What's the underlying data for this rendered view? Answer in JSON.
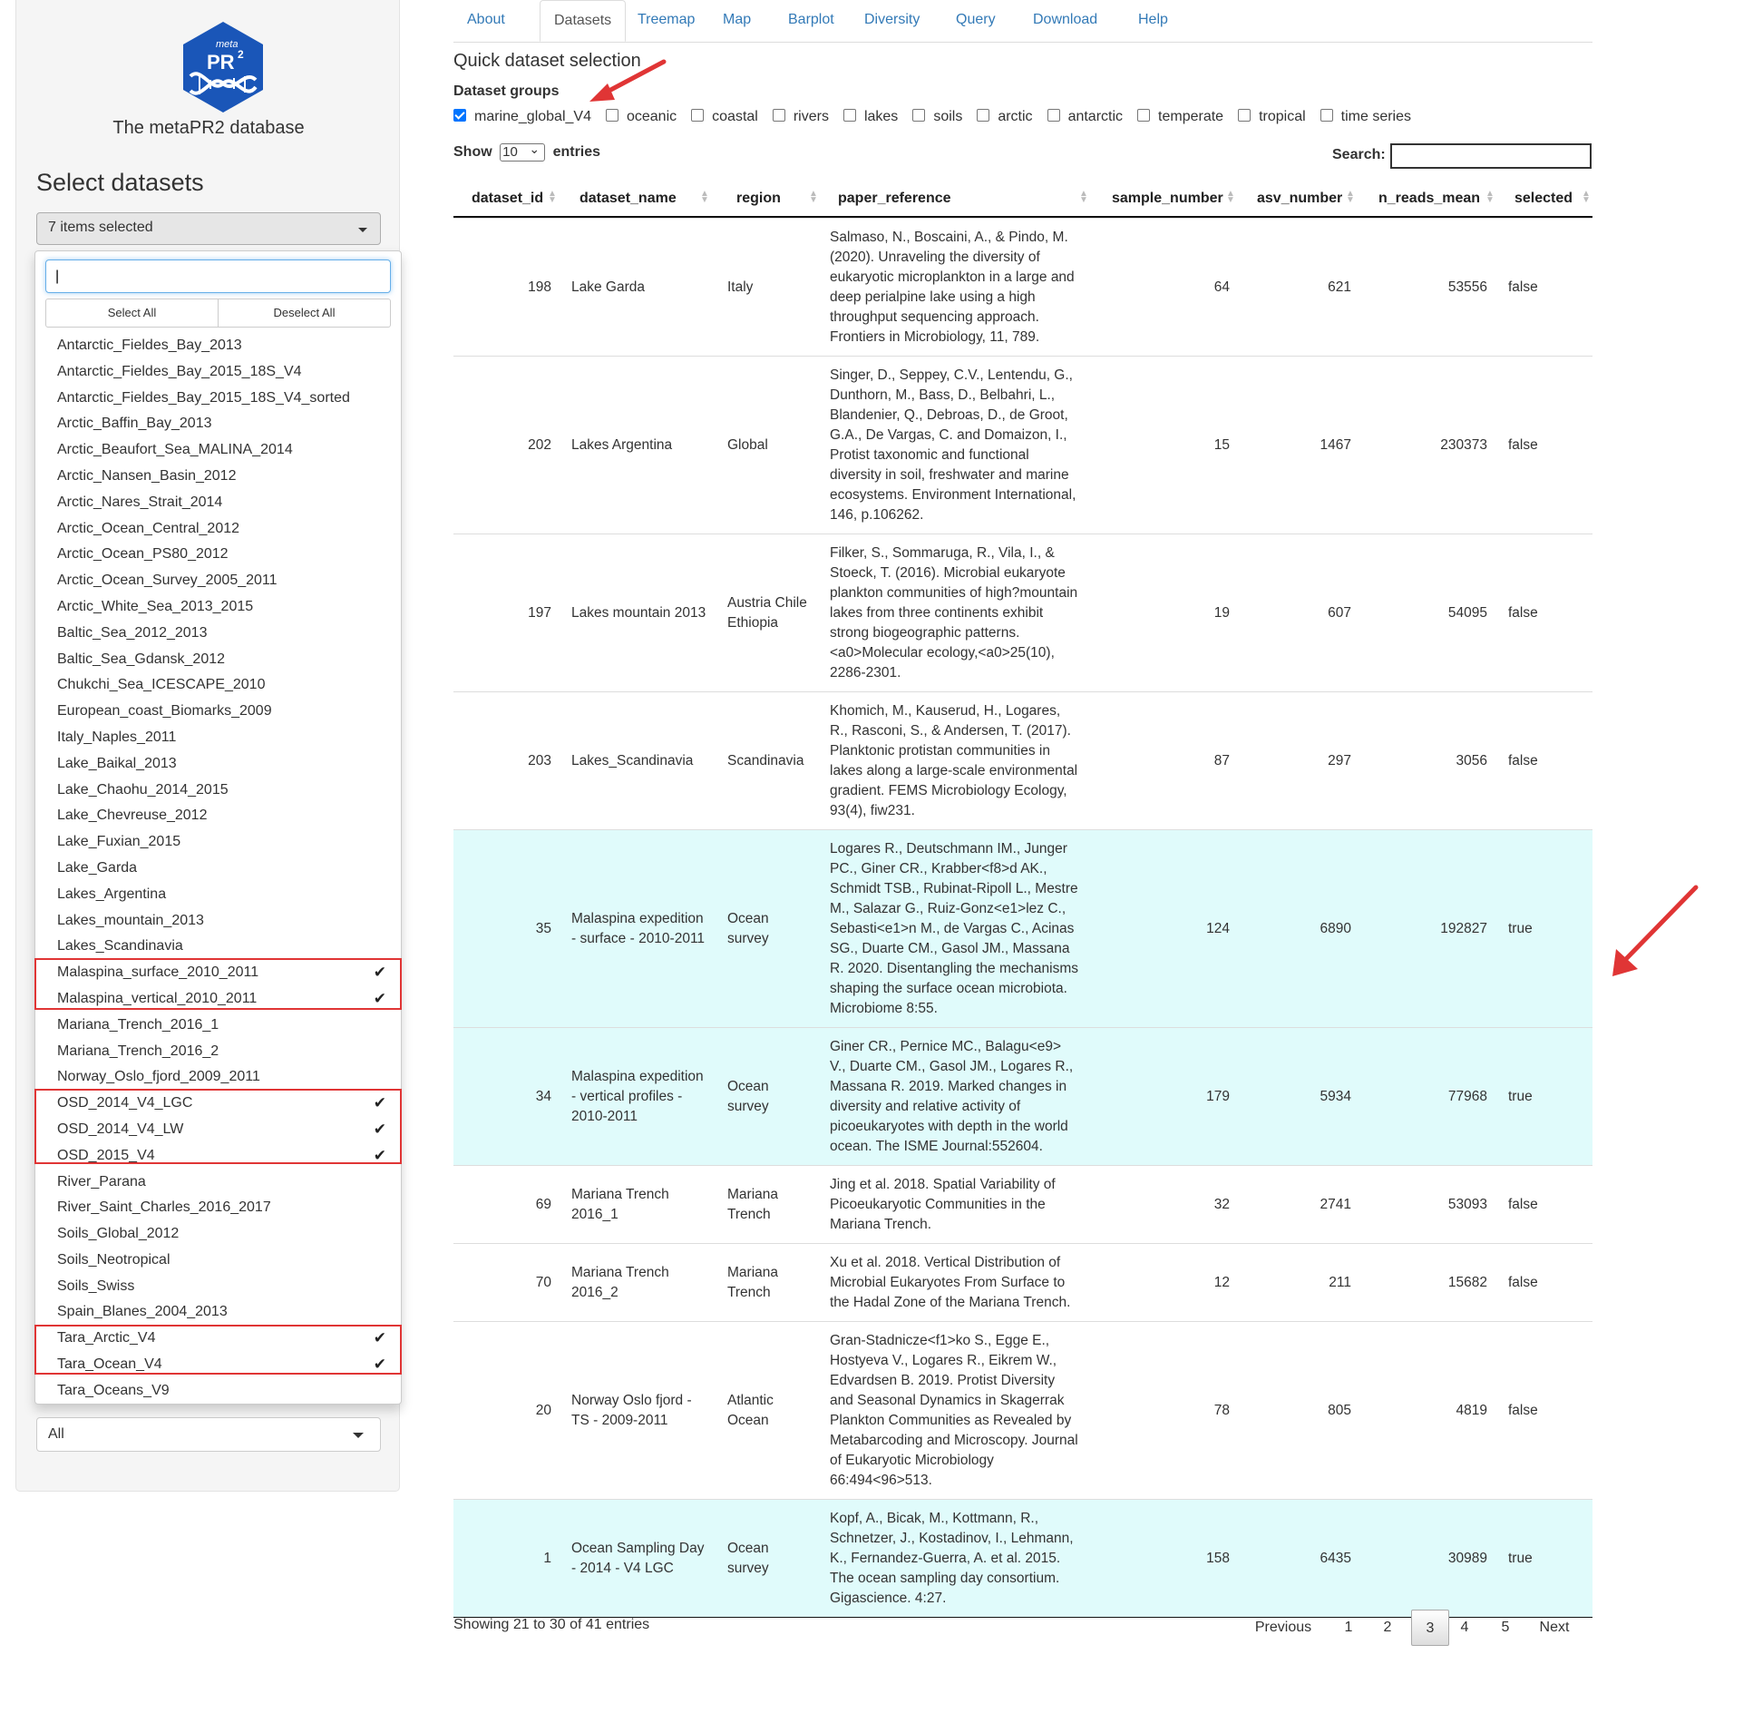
{
  "app": {
    "logo_top": "meta",
    "logo_main": "PR",
    "logo_sup": "2",
    "name": "The metaPR2 database",
    "select_title": "Select datasets",
    "selected_summary": "7 items selected",
    "species_value": "All"
  },
  "dropdown": {
    "search_value": "|",
    "select_all": "Select All",
    "deselect_all": "Deselect All",
    "items": [
      {
        "label": "Antarctic_Fieldes_Bay_2013",
        "checked": false
      },
      {
        "label": "Antarctic_Fieldes_Bay_2015_18S_V4",
        "checked": false
      },
      {
        "label": "Antarctic_Fieldes_Bay_2015_18S_V4_sorted",
        "checked": false
      },
      {
        "label": "Arctic_Baffin_Bay_2013",
        "checked": false
      },
      {
        "label": "Arctic_Beaufort_Sea_MALINA_2014",
        "checked": false
      },
      {
        "label": "Arctic_Nansen_Basin_2012",
        "checked": false
      },
      {
        "label": "Arctic_Nares_Strait_2014",
        "checked": false
      },
      {
        "label": "Arctic_Ocean_Central_2012",
        "checked": false
      },
      {
        "label": "Arctic_Ocean_PS80_2012",
        "checked": false
      },
      {
        "label": "Arctic_Ocean_Survey_2005_2011",
        "checked": false
      },
      {
        "label": "Arctic_White_Sea_2013_2015",
        "checked": false
      },
      {
        "label": "Baltic_Sea_2012_2013",
        "checked": false
      },
      {
        "label": "Baltic_Sea_Gdansk_2012",
        "checked": false
      },
      {
        "label": "Chukchi_Sea_ICESCAPE_2010",
        "checked": false
      },
      {
        "label": "European_coast_Biomarks_2009",
        "checked": false
      },
      {
        "label": "Italy_Naples_2011",
        "checked": false
      },
      {
        "label": "Lake_Baikal_2013",
        "checked": false
      },
      {
        "label": "Lake_Chaohu_2014_2015",
        "checked": false
      },
      {
        "label": "Lake_Chevreuse_2012",
        "checked": false
      },
      {
        "label": "Lake_Fuxian_2015",
        "checked": false
      },
      {
        "label": "Lake_Garda",
        "checked": false
      },
      {
        "label": "Lakes_Argentina",
        "checked": false
      },
      {
        "label": "Lakes_mountain_2013",
        "checked": false
      },
      {
        "label": "Lakes_Scandinavia",
        "checked": false
      },
      {
        "label": "Malaspina_surface_2010_2011",
        "checked": true
      },
      {
        "label": "Malaspina_vertical_2010_2011",
        "checked": true
      },
      {
        "label": "Mariana_Trench_2016_1",
        "checked": false
      },
      {
        "label": "Mariana_Trench_2016_2",
        "checked": false
      },
      {
        "label": "Norway_Oslo_fjord_2009_2011",
        "checked": false
      },
      {
        "label": "OSD_2014_V4_LGC",
        "checked": true
      },
      {
        "label": "OSD_2014_V4_LW",
        "checked": true
      },
      {
        "label": "OSD_2015_V4",
        "checked": true
      },
      {
        "label": "River_Parana",
        "checked": false
      },
      {
        "label": "River_Saint_Charles_2016_2017",
        "checked": false
      },
      {
        "label": "Soils_Global_2012",
        "checked": false
      },
      {
        "label": "Soils_Neotropical",
        "checked": false
      },
      {
        "label": "Soils_Swiss",
        "checked": false
      },
      {
        "label": "Spain_Blanes_2004_2013",
        "checked": false
      },
      {
        "label": "Tara_Arctic_V4",
        "checked": true
      },
      {
        "label": "Tara_Ocean_V4",
        "checked": true
      },
      {
        "label": "Tara_Oceans_V9",
        "checked": false
      }
    ]
  },
  "tabs": [
    {
      "label": "About",
      "active": false
    },
    {
      "label": "Datasets",
      "active": true
    },
    {
      "label": "Treemap",
      "active": false
    },
    {
      "label": "Map",
      "active": false
    },
    {
      "label": "Barplot",
      "active": false
    },
    {
      "label": "Diversity",
      "active": false
    },
    {
      "label": "Query",
      "active": false
    },
    {
      "label": "Download",
      "active": false
    },
    {
      "label": "Help",
      "active": false
    }
  ],
  "quick": {
    "title": "Quick dataset selection",
    "groups_label": "Dataset groups",
    "groups": [
      {
        "label": "marine_global_V4",
        "checked": true
      },
      {
        "label": "oceanic",
        "checked": false
      },
      {
        "label": "coastal",
        "checked": false
      },
      {
        "label": "rivers",
        "checked": false
      },
      {
        "label": "lakes",
        "checked": false
      },
      {
        "label": "soils",
        "checked": false
      },
      {
        "label": "arctic",
        "checked": false
      },
      {
        "label": "antarctic",
        "checked": false
      },
      {
        "label": "temperate",
        "checked": false
      },
      {
        "label": "tropical",
        "checked": false
      },
      {
        "label": "time series",
        "checked": false
      }
    ]
  },
  "table": {
    "show_label": "Show",
    "entries_label": "entries",
    "page_length": "10",
    "search_label": "Search:",
    "search_value": "",
    "columns": [
      "dataset_id",
      "dataset_name",
      "region",
      "paper_reference",
      "sample_number",
      "asv_number",
      "n_reads_mean",
      "selected"
    ],
    "rows": [
      {
        "id": "198",
        "name": [
          "Lake Garda"
        ],
        "region": [
          "Italy"
        ],
        "ref": [
          "Salmaso, N., Boscaini, A., & Pindo, M.",
          "(2020). Unraveling the diversity of",
          "eukaryotic microplankton in a large and",
          "deep perialpine lake using a high",
          "throughput sequencing approach.",
          "Frontiers in Microbiology, 11, 789."
        ],
        "samples": "64",
        "asv": "621",
        "reads": "53556",
        "selected": "false"
      },
      {
        "id": "202",
        "name": [
          "Lakes Argentina"
        ],
        "region": [
          "Global"
        ],
        "ref": [
          "Singer, D., Seppey, C.V., Lentendu, G.,",
          "Dunthorn, M., Bass, D., Belbahri, L.,",
          "Blandenier, Q., Debroas, D., de Groot,",
          "G.A., De Vargas, C. and Domaizon, I.,",
          "Protist taxonomic and functional",
          "diversity in soil, freshwater and marine",
          "ecosystems. Environment International,",
          "146, p.106262."
        ],
        "samples": "15",
        "asv": "1467",
        "reads": "230373",
        "selected": "false"
      },
      {
        "id": "197",
        "name": [
          "Lakes mountain 2013"
        ],
        "region": [
          "Austria Chile",
          "Ethiopia"
        ],
        "ref": [
          "Filker, S., Sommaruga, R., Vila, I., &",
          "Stoeck, T. (2016). Microbial eukaryote",
          "plankton communities of high?mountain",
          "lakes from three continents exhibit",
          "strong biogeographic patterns.",
          "<a0>Molecular ecology,<a0>25(10),",
          "2286-2301."
        ],
        "samples": "19",
        "asv": "607",
        "reads": "54095",
        "selected": "false"
      },
      {
        "id": "203",
        "name": [
          "Lakes_Scandinavia"
        ],
        "region": [
          "Scandinavia"
        ],
        "ref": [
          "Khomich, M., Kauserud, H., Logares,",
          "R., Rasconi, S., & Andersen, T. (2017).",
          "Planktonic protistan communities in",
          "lakes along a large-scale environmental",
          "gradient. FEMS Microbiology Ecology,",
          "93(4), fiw231."
        ],
        "samples": "87",
        "asv": "297",
        "reads": "3056",
        "selected": "false"
      },
      {
        "id": "35",
        "name": [
          "Malaspina expedition",
          "- surface - 2010-2011"
        ],
        "region": [
          "Ocean",
          "survey"
        ],
        "ref": [
          "Logares R., Deutschmann IM., Junger",
          "PC., Giner CR., Krabber<f8>d AK.,",
          "Schmidt TSB., Rubinat-Ripoll L., Mestre",
          "M., Salazar G., Ruiz-Gonz<e1>lez C.,",
          "Sebasti<e1>n M., de Vargas C., Acinas",
          "SG., Duarte CM., Gasol JM., Massana",
          "R. 2020. Disentangling the mechanisms",
          "shaping the surface ocean microbiota.",
          "Microbiome 8:55."
        ],
        "samples": "124",
        "asv": "6890",
        "reads": "192827",
        "selected": "true"
      },
      {
        "id": "34",
        "name": [
          "Malaspina expedition",
          "- vertical profiles -",
          "2010-2011"
        ],
        "region": [
          "Ocean",
          "survey"
        ],
        "ref": [
          "Giner CR., Pernice MC., Balagu<e9>",
          "V., Duarte CM., Gasol JM., Logares R.,",
          "Massana R. 2019. Marked changes in",
          "diversity and relative activity of",
          "picoeukaryotes with depth in the world",
          "ocean. The ISME Journal:552604."
        ],
        "samples": "179",
        "asv": "5934",
        "reads": "77968",
        "selected": "true"
      },
      {
        "id": "69",
        "name": [
          "Mariana Trench",
          "2016_1"
        ],
        "region": [
          "Mariana",
          "Trench"
        ],
        "ref": [
          "Jing et al. 2018. Spatial Variability of",
          "Picoeukaryotic Communities in the",
          "Mariana Trench."
        ],
        "samples": "32",
        "asv": "2741",
        "reads": "53093",
        "selected": "false"
      },
      {
        "id": "70",
        "name": [
          "Mariana Trench",
          "2016_2"
        ],
        "region": [
          "Mariana",
          "Trench"
        ],
        "ref": [
          "Xu et al. 2018. Vertical Distribution of",
          "Microbial Eukaryotes From Surface to",
          "the Hadal Zone of the Mariana Trench."
        ],
        "samples": "12",
        "asv": "211",
        "reads": "15682",
        "selected": "false"
      },
      {
        "id": "20",
        "name": [
          "Norway Oslo fjord -",
          "TS - 2009-2011"
        ],
        "region": [
          "Atlantic",
          "Ocean"
        ],
        "ref": [
          "Gran-Stadnicze<f1>ko S., Egge E.,",
          "Hostyeva V., Logares R., Eikrem W.,",
          "Edvardsen B. 2019. Protist Diversity",
          "and Seasonal Dynamics in Skagerrak",
          "Plankton Communities as Revealed by",
          "Metabarcoding and Microscopy. Journal",
          "of Eukaryotic Microbiology",
          "66:494<96>513."
        ],
        "samples": "78",
        "asv": "805",
        "reads": "4819",
        "selected": "false"
      },
      {
        "id": "1",
        "name": [
          "Ocean Sampling Day",
          "- 2014 - V4 LGC"
        ],
        "region": [
          "Ocean",
          "survey"
        ],
        "ref": [
          "Kopf, A., Bicak, M., Kottmann, R.,",
          "Schnetzer, J., Kostadinov, I., Lehmann,",
          "K., Fernandez-Guerra, A. et al. 2015.",
          "The ocean sampling day consortium.",
          "Gigascience. 4:27."
        ],
        "samples": "158",
        "asv": "6435",
        "reads": "30989",
        "selected": "true"
      }
    ],
    "info": "Showing 21 to 30 of 41 entries",
    "pagination": [
      "Previous",
      "1",
      "2",
      "3",
      "4",
      "5",
      "Next"
    ],
    "current_page": "3"
  },
  "colors": {
    "selected_row": "#e0fbfb",
    "annotation_red": "#e03535",
    "link": "#337ab7"
  }
}
